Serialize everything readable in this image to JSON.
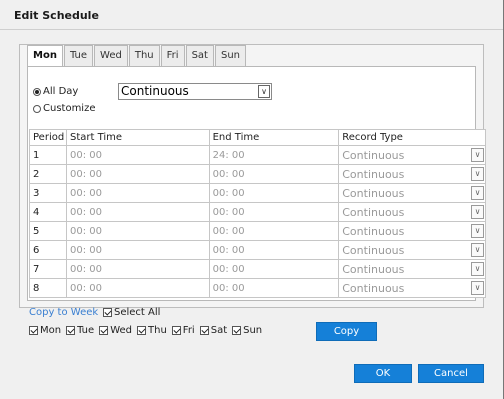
{
  "dialog": {
    "title": "Edit Schedule"
  },
  "tabs": [
    {
      "label": "Mon",
      "active": true
    },
    {
      "label": "Tue"
    },
    {
      "label": "Wed"
    },
    {
      "label": "Thu"
    },
    {
      "label": "Fri"
    },
    {
      "label": "Sat"
    },
    {
      "label": "Sun"
    }
  ],
  "mode": {
    "all_day_label": "All Day",
    "customize_label": "Customize",
    "selected": "All Day",
    "select_value": "Continuous"
  },
  "table": {
    "headers": [
      "Period",
      "Start Time",
      "End Time",
      "Record Type"
    ],
    "rows": [
      {
        "period": "1",
        "start": "00: 00",
        "end": "24: 00",
        "type": "Continuous"
      },
      {
        "period": "2",
        "start": "00: 00",
        "end": "00: 00",
        "type": "Continuous"
      },
      {
        "period": "3",
        "start": "00: 00",
        "end": "00: 00",
        "type": "Continuous"
      },
      {
        "period": "4",
        "start": "00: 00",
        "end": "00: 00",
        "type": "Continuous"
      },
      {
        "period": "5",
        "start": "00: 00",
        "end": "00: 00",
        "type": "Continuous"
      },
      {
        "period": "6",
        "start": "00: 00",
        "end": "00: 00",
        "type": "Continuous"
      },
      {
        "period": "7",
        "start": "00: 00",
        "end": "00: 00",
        "type": "Continuous"
      },
      {
        "period": "8",
        "start": "00: 00",
        "end": "00: 00",
        "type": "Continuous"
      }
    ]
  },
  "copy": {
    "link_label": "Copy to Week",
    "select_all_label": "Select All",
    "days": [
      {
        "label": "Mon",
        "checked": true
      },
      {
        "label": "Tue",
        "checked": true
      },
      {
        "label": "Wed",
        "checked": true
      },
      {
        "label": "Thu",
        "checked": true
      },
      {
        "label": "Fri",
        "checked": true
      },
      {
        "label": "Sat",
        "checked": true
      },
      {
        "label": "Sun",
        "checked": true
      }
    ],
    "copy_button": "Copy"
  },
  "footer": {
    "ok_label": "OK",
    "cancel_label": "Cancel"
  },
  "colors": {
    "accent": "#1580d8",
    "link": "#3a7fd1"
  },
  "icons": {
    "dropdown": "chevron-down-icon",
    "check": "checkmark-icon"
  }
}
